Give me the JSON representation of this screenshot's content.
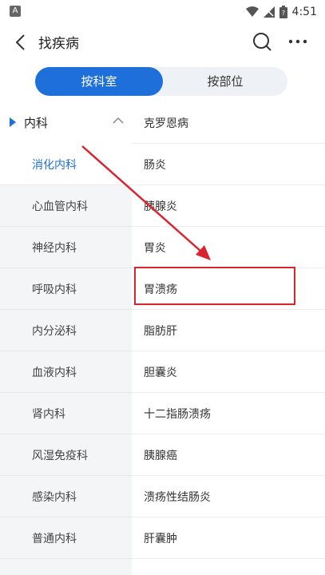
{
  "status_bar": {
    "badge": "A",
    "time": "4:51"
  },
  "header": {
    "title": "找疾病"
  },
  "segments": {
    "left": "按科室",
    "right": "按部位"
  },
  "department_group": {
    "label": "内科"
  },
  "departments": [
    {
      "label": "消化内科",
      "active": true
    },
    {
      "label": "心血管内科",
      "active": false
    },
    {
      "label": "神经内科",
      "active": false
    },
    {
      "label": "呼吸内科",
      "active": false
    },
    {
      "label": "内分泌科",
      "active": false
    },
    {
      "label": "血液内科",
      "active": false
    },
    {
      "label": "肾内科",
      "active": false
    },
    {
      "label": "风湿免疫科",
      "active": false
    },
    {
      "label": "感染内科",
      "active": false
    },
    {
      "label": "普通内科",
      "active": false
    }
  ],
  "diseases": [
    {
      "label": "克罗恩病"
    },
    {
      "label": "肠炎"
    },
    {
      "label": "胰腺炎"
    },
    {
      "label": "胃炎"
    },
    {
      "label": "胃溃疡"
    },
    {
      "label": "脂肪肝"
    },
    {
      "label": "胆囊炎"
    },
    {
      "label": "十二指肠溃疡"
    },
    {
      "label": "胰腺癌"
    },
    {
      "label": "溃疡性结肠炎"
    },
    {
      "label": "肝囊肿"
    }
  ],
  "colors": {
    "accent": "#1e6fd9",
    "annotation": "#d9232e"
  }
}
